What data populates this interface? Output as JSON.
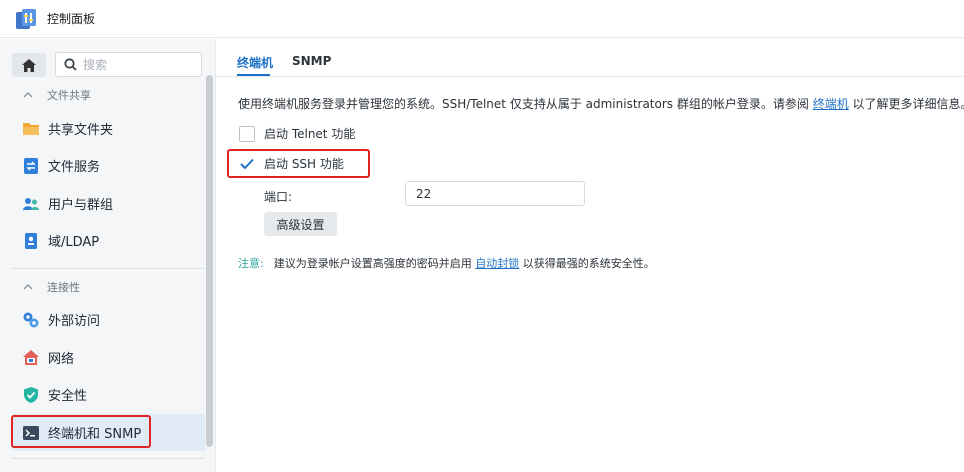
{
  "window": {
    "title": "控制面板"
  },
  "sidebar": {
    "search_placeholder": "搜索",
    "groups": [
      {
        "label": "文件共享"
      },
      {
        "label": "连接性"
      }
    ],
    "items": [
      {
        "label": "共享文件夹",
        "icon": "folder-icon"
      },
      {
        "label": "文件服务",
        "icon": "file-services-icon"
      },
      {
        "label": "用户与群组",
        "icon": "users-icon"
      },
      {
        "label": "域/LDAP",
        "icon": "ldap-icon"
      },
      {
        "label": "外部访问",
        "icon": "external-access-icon"
      },
      {
        "label": "网络",
        "icon": "network-icon"
      },
      {
        "label": "安全性",
        "icon": "shield-icon"
      },
      {
        "label": "终端机和 SNMP",
        "icon": "terminal-icon",
        "active": true
      }
    ]
  },
  "main": {
    "tabs": [
      {
        "label": "终端机",
        "active": true
      },
      {
        "label": "SNMP",
        "active": false
      }
    ],
    "description_before": "使用终端机服务登录并管理您的系统。SSH/Telnet 仅支持从属于 administrators 群组的帐户登录。请参阅 ",
    "description_link": "终端机",
    "description_after": " 以了解更多详细信息。",
    "telnet_label": "启动 Telnet 功能",
    "telnet_checked": false,
    "ssh_label": "启动 SSH 功能",
    "ssh_checked": true,
    "port_label": "端口:",
    "port_value": "22",
    "advanced_button": "高级设置",
    "note_label": "注意:",
    "note_before": "建议为登录帐户设置高强度的密码并启用 ",
    "note_link": "自动封锁",
    "note_after": " 以获得最强的系统安全性。"
  },
  "colors": {
    "accent": "#1f72c7",
    "highlight": "#e02424",
    "note": "#2aa198"
  }
}
